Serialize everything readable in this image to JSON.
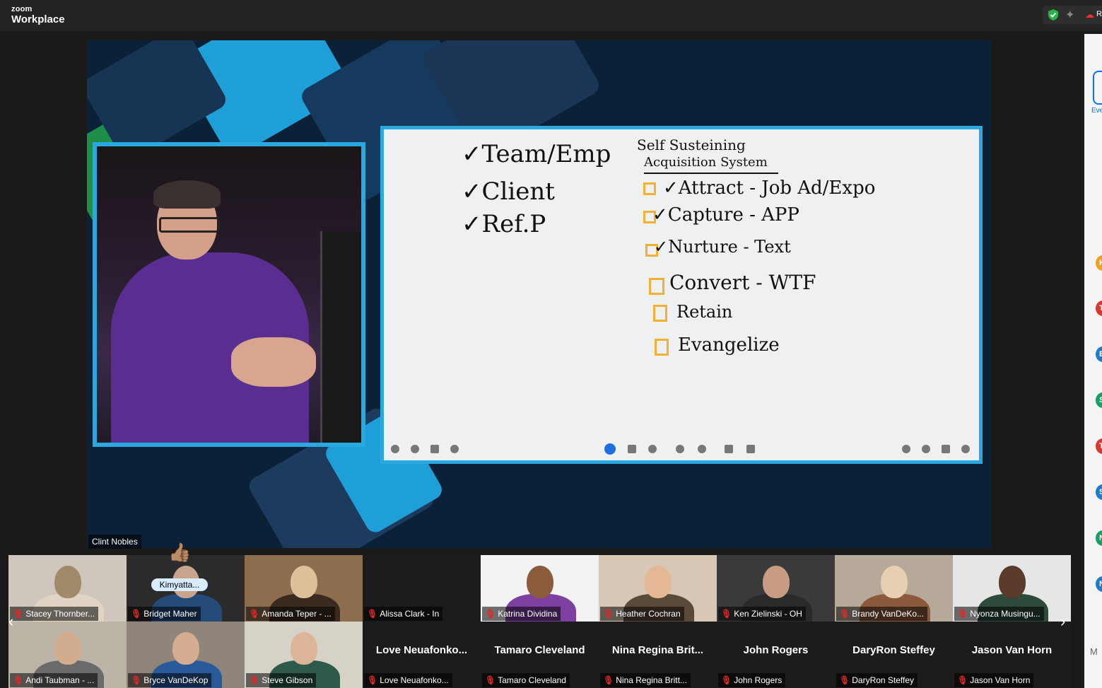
{
  "titlebar": {
    "brand_small": "zoom",
    "brand_main": "Workplace",
    "right_label": "R"
  },
  "share": {
    "speaker_name": "Clint Nobles",
    "whiteboard": {
      "left_list": [
        "✓Team/Emp",
        "✓Client",
        "✓Ref.P"
      ],
      "title_line1": "Self Susteining",
      "title_line2": "Acquisition System",
      "items": [
        {
          "label": "Attract - Job Ad/Expo",
          "checked": true
        },
        {
          "label": "Capture - APP",
          "checked": true
        },
        {
          "label": "Nurture - Text",
          "checked": true
        },
        {
          "label": "Convert - WTF",
          "checked": false
        },
        {
          "label": "Retain",
          "checked": false
        },
        {
          "label": "Evangelize",
          "checked": false
        }
      ]
    }
  },
  "side_panel": {
    "top_label": "Eve",
    "avatars": [
      {
        "letter": "K",
        "color": "#f0a020"
      },
      {
        "letter": "T",
        "color": "#d83a2e"
      },
      {
        "letter": "B",
        "color": "#1f7bc8"
      },
      {
        "letter": "S",
        "color": "#19a062"
      },
      {
        "letter": "T",
        "color": "#d83a2e"
      },
      {
        "letter": "S",
        "color": "#1f7bc8"
      },
      {
        "letter": "N",
        "color": "#19a062"
      },
      {
        "letter": "N",
        "color": "#1f7bc8"
      }
    ],
    "bottom_label": "M"
  },
  "gallery": {
    "reaction": "👍🏽",
    "rename_pill": "Kimyatta...",
    "row1": [
      {
        "name": "Stacey Thornber...",
        "video": true
      },
      {
        "name": "Bridget Maher",
        "video": true
      },
      {
        "name": "Amanda Teper - ...",
        "video": true
      },
      {
        "name": "Alissa Clark - In",
        "video": false
      },
      {
        "name": "Katrina Dividina",
        "video": true
      },
      {
        "name": "Heather Cochran",
        "video": true
      },
      {
        "name": "Ken Zielinski - OH",
        "video": true
      },
      {
        "name": "Brandy VanDeKo...",
        "video": true
      },
      {
        "name": "Nyonza Musingu...",
        "video": true
      }
    ],
    "row2": [
      {
        "name": "Andi Taubman - ...",
        "video": true,
        "big": ""
      },
      {
        "name": "Bryce VanDeKop",
        "video": true,
        "big": ""
      },
      {
        "name": "Steve Gibson",
        "video": true,
        "big": ""
      },
      {
        "name": "Love Neuafonko...",
        "video": false,
        "big": "Love  Neuafonko..."
      },
      {
        "name": "Tamaro Cleveland",
        "video": false,
        "big": "Tamaro Cleveland"
      },
      {
        "name": "Nina Regina Britt...",
        "video": false,
        "big": "Nina  Regina  Brit..."
      },
      {
        "name": "John Rogers",
        "video": false,
        "big": "John Rogers"
      },
      {
        "name": "DaryRon Steffey",
        "video": false,
        "big": "DaryRon Steffey"
      },
      {
        "name": "Jason Van Horn",
        "video": false,
        "big": "Jason Van Horn"
      }
    ]
  }
}
